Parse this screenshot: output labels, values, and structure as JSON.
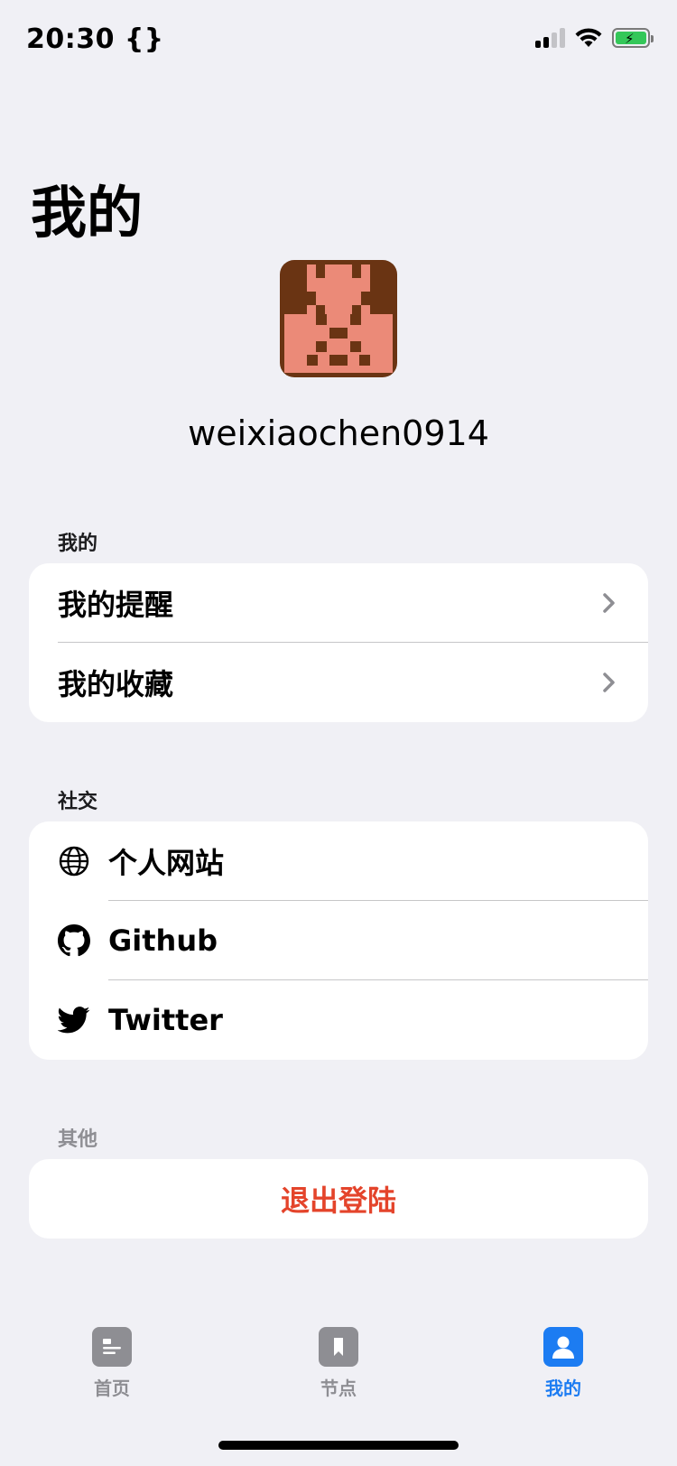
{
  "status_bar": {
    "time": "20:30 {}"
  },
  "title": "我的",
  "profile": {
    "username": "weixiaochen0914",
    "avatar_colors": [
      "#6a3413",
      "#eb8a78"
    ]
  },
  "sections": {
    "mine": {
      "header": "我的",
      "items": [
        {
          "label": "我的提醒"
        },
        {
          "label": "我的收藏"
        }
      ]
    },
    "social": {
      "header": "社交",
      "items": [
        {
          "label": "个人网站",
          "icon": "globe-icon"
        },
        {
          "label": "Github",
          "icon": "github-icon"
        },
        {
          "label": "Twitter",
          "icon": "twitter-icon"
        }
      ]
    },
    "other": {
      "header": "其他",
      "logout_label": "退出登陆",
      "logout_color": "#e4442b"
    }
  },
  "tab_bar": {
    "tabs": [
      {
        "label": "首页",
        "icon": "newspaper-icon",
        "active": false
      },
      {
        "label": "节点",
        "icon": "bookmark-icon",
        "active": false
      },
      {
        "label": "我的",
        "icon": "person-icon",
        "active": true
      }
    ],
    "active_color": "#1c7cf2",
    "inactive_color": "#8e8e93"
  }
}
